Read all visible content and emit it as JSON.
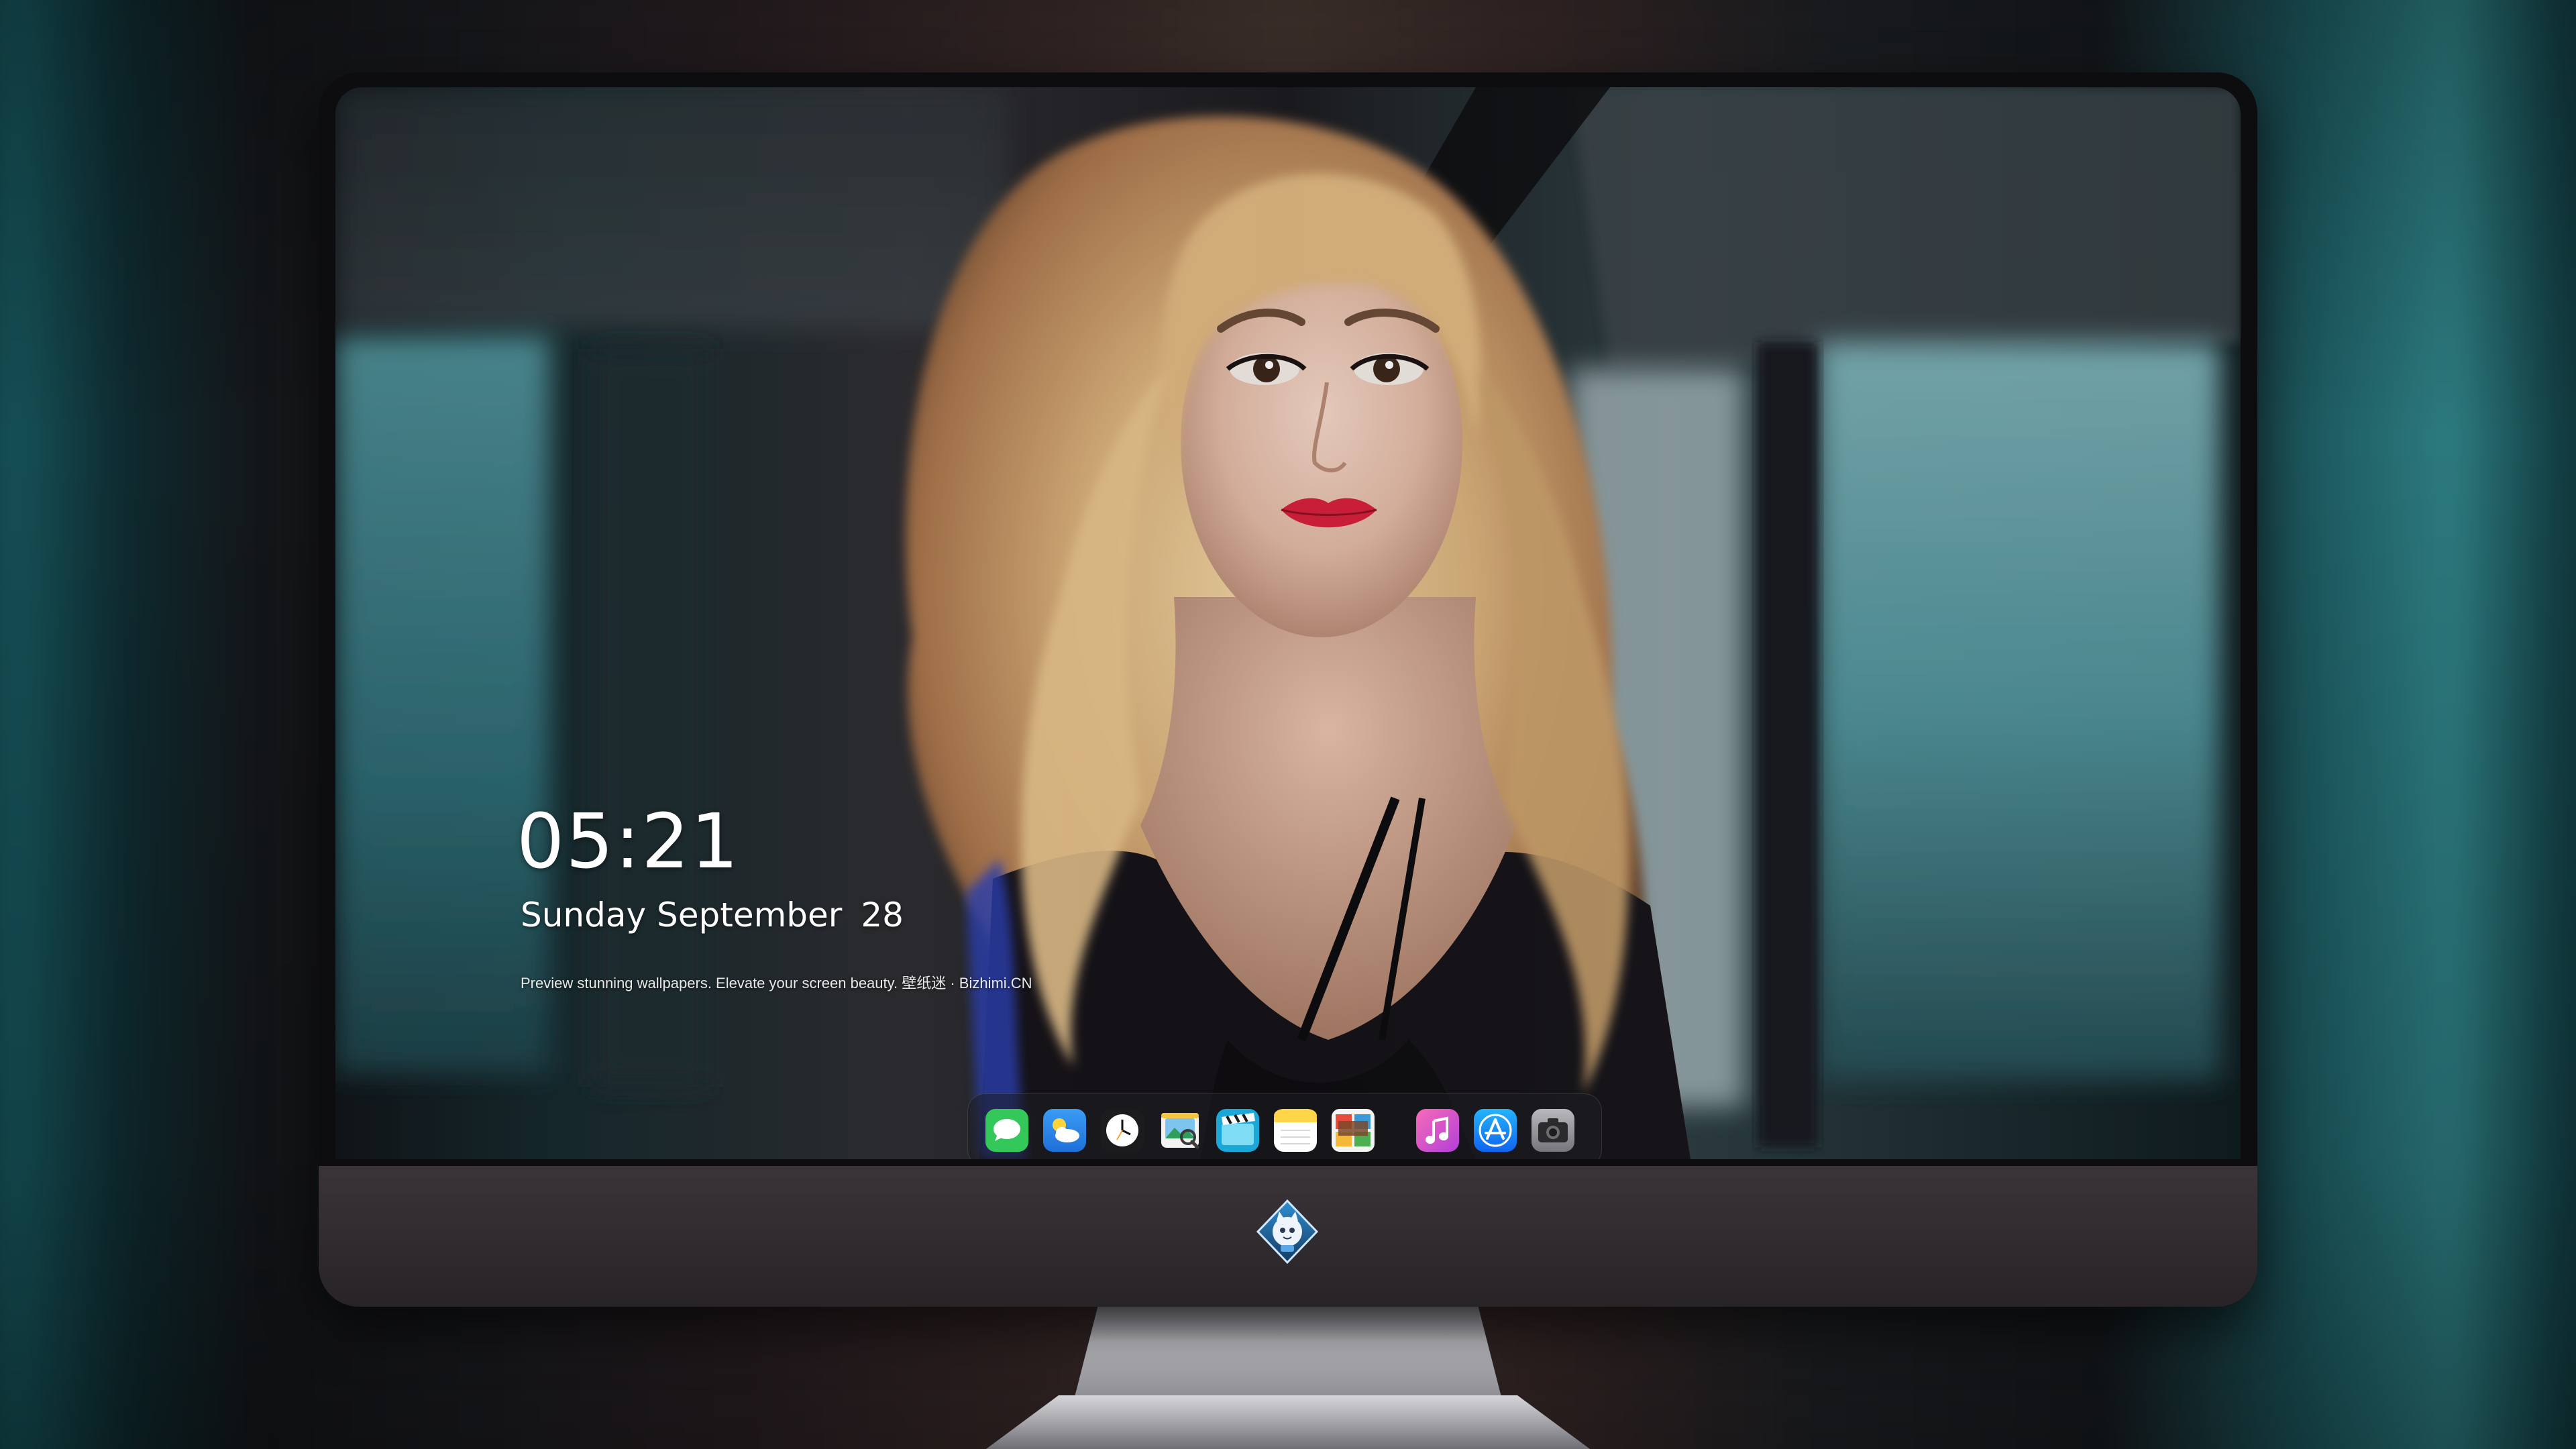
{
  "lock_screen": {
    "time": "05:21",
    "weekday_month": "Sunday September",
    "day": "28",
    "tagline": "Preview stunning wallpapers. Elevate your screen beauty. 壁纸迷 · Bizhimi.CN"
  },
  "dock": {
    "apps": [
      {
        "icon": "messages-icon",
        "color": "#34c759"
      },
      {
        "icon": "weather-icon",
        "color": "#2f8cf0"
      },
      {
        "icon": "clock-icon",
        "color": "#1c1c1e"
      },
      {
        "icon": "preview-icon",
        "color": "#f2f2f2"
      },
      {
        "icon": "clips-icon",
        "color": "#1aa8d8"
      },
      {
        "icon": "notes-icon",
        "color": "#ffd54a"
      },
      {
        "icon": "photo-booth-icon",
        "color": "#f4f4f4"
      },
      {
        "icon": "music-icon",
        "color": "#f0479c"
      },
      {
        "icon": "app-store-icon",
        "color": "#1c8ef5"
      },
      {
        "icon": "camera-icon",
        "color": "#8e8e93"
      }
    ]
  },
  "monitor": {
    "logo_icon": "cat-astronaut-logo-icon"
  },
  "colors": {
    "lip": "#d81e3a",
    "hair": "#d9b07a",
    "room_teal": "#2a7479",
    "bezel": "#0d0d0f",
    "chin": "#2f2a2e"
  }
}
